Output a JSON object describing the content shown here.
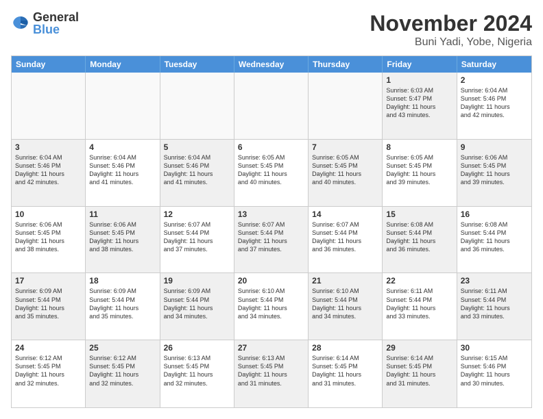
{
  "logo": {
    "general": "General",
    "blue": "Blue"
  },
  "title": "November 2024",
  "location": "Buni Yadi, Yobe, Nigeria",
  "header_days": [
    "Sunday",
    "Monday",
    "Tuesday",
    "Wednesday",
    "Thursday",
    "Friday",
    "Saturday"
  ],
  "weeks": [
    [
      {
        "day": "",
        "text": "",
        "empty": true
      },
      {
        "day": "",
        "text": "",
        "empty": true
      },
      {
        "day": "",
        "text": "",
        "empty": true
      },
      {
        "day": "",
        "text": "",
        "empty": true
      },
      {
        "day": "",
        "text": "",
        "empty": true
      },
      {
        "day": "1",
        "text": "Sunrise: 6:03 AM\nSunset: 5:47 PM\nDaylight: 11 hours\nand 43 minutes.",
        "shaded": true
      },
      {
        "day": "2",
        "text": "Sunrise: 6:04 AM\nSunset: 5:46 PM\nDaylight: 11 hours\nand 42 minutes.",
        "shaded": false
      }
    ],
    [
      {
        "day": "3",
        "text": "Sunrise: 6:04 AM\nSunset: 5:46 PM\nDaylight: 11 hours\nand 42 minutes.",
        "shaded": true
      },
      {
        "day": "4",
        "text": "Sunrise: 6:04 AM\nSunset: 5:46 PM\nDaylight: 11 hours\nand 41 minutes.",
        "shaded": false
      },
      {
        "day": "5",
        "text": "Sunrise: 6:04 AM\nSunset: 5:46 PM\nDaylight: 11 hours\nand 41 minutes.",
        "shaded": true
      },
      {
        "day": "6",
        "text": "Sunrise: 6:05 AM\nSunset: 5:45 PM\nDaylight: 11 hours\nand 40 minutes.",
        "shaded": false
      },
      {
        "day": "7",
        "text": "Sunrise: 6:05 AM\nSunset: 5:45 PM\nDaylight: 11 hours\nand 40 minutes.",
        "shaded": true
      },
      {
        "day": "8",
        "text": "Sunrise: 6:05 AM\nSunset: 5:45 PM\nDaylight: 11 hours\nand 39 minutes.",
        "shaded": false
      },
      {
        "day": "9",
        "text": "Sunrise: 6:06 AM\nSunset: 5:45 PM\nDaylight: 11 hours\nand 39 minutes.",
        "shaded": true
      }
    ],
    [
      {
        "day": "10",
        "text": "Sunrise: 6:06 AM\nSunset: 5:45 PM\nDaylight: 11 hours\nand 38 minutes.",
        "shaded": false
      },
      {
        "day": "11",
        "text": "Sunrise: 6:06 AM\nSunset: 5:45 PM\nDaylight: 11 hours\nand 38 minutes.",
        "shaded": true
      },
      {
        "day": "12",
        "text": "Sunrise: 6:07 AM\nSunset: 5:44 PM\nDaylight: 11 hours\nand 37 minutes.",
        "shaded": false
      },
      {
        "day": "13",
        "text": "Sunrise: 6:07 AM\nSunset: 5:44 PM\nDaylight: 11 hours\nand 37 minutes.",
        "shaded": true
      },
      {
        "day": "14",
        "text": "Sunrise: 6:07 AM\nSunset: 5:44 PM\nDaylight: 11 hours\nand 36 minutes.",
        "shaded": false
      },
      {
        "day": "15",
        "text": "Sunrise: 6:08 AM\nSunset: 5:44 PM\nDaylight: 11 hours\nand 36 minutes.",
        "shaded": true
      },
      {
        "day": "16",
        "text": "Sunrise: 6:08 AM\nSunset: 5:44 PM\nDaylight: 11 hours\nand 36 minutes.",
        "shaded": false
      }
    ],
    [
      {
        "day": "17",
        "text": "Sunrise: 6:09 AM\nSunset: 5:44 PM\nDaylight: 11 hours\nand 35 minutes.",
        "shaded": true
      },
      {
        "day": "18",
        "text": "Sunrise: 6:09 AM\nSunset: 5:44 PM\nDaylight: 11 hours\nand 35 minutes.",
        "shaded": false
      },
      {
        "day": "19",
        "text": "Sunrise: 6:09 AM\nSunset: 5:44 PM\nDaylight: 11 hours\nand 34 minutes.",
        "shaded": true
      },
      {
        "day": "20",
        "text": "Sunrise: 6:10 AM\nSunset: 5:44 PM\nDaylight: 11 hours\nand 34 minutes.",
        "shaded": false
      },
      {
        "day": "21",
        "text": "Sunrise: 6:10 AM\nSunset: 5:44 PM\nDaylight: 11 hours\nand 34 minutes.",
        "shaded": true
      },
      {
        "day": "22",
        "text": "Sunrise: 6:11 AM\nSunset: 5:44 PM\nDaylight: 11 hours\nand 33 minutes.",
        "shaded": false
      },
      {
        "day": "23",
        "text": "Sunrise: 6:11 AM\nSunset: 5:44 PM\nDaylight: 11 hours\nand 33 minutes.",
        "shaded": true
      }
    ],
    [
      {
        "day": "24",
        "text": "Sunrise: 6:12 AM\nSunset: 5:45 PM\nDaylight: 11 hours\nand 32 minutes.",
        "shaded": false
      },
      {
        "day": "25",
        "text": "Sunrise: 6:12 AM\nSunset: 5:45 PM\nDaylight: 11 hours\nand 32 minutes.",
        "shaded": true
      },
      {
        "day": "26",
        "text": "Sunrise: 6:13 AM\nSunset: 5:45 PM\nDaylight: 11 hours\nand 32 minutes.",
        "shaded": false
      },
      {
        "day": "27",
        "text": "Sunrise: 6:13 AM\nSunset: 5:45 PM\nDaylight: 11 hours\nand 31 minutes.",
        "shaded": true
      },
      {
        "day": "28",
        "text": "Sunrise: 6:14 AM\nSunset: 5:45 PM\nDaylight: 11 hours\nand 31 minutes.",
        "shaded": false
      },
      {
        "day": "29",
        "text": "Sunrise: 6:14 AM\nSunset: 5:45 PM\nDaylight: 11 hours\nand 31 minutes.",
        "shaded": true
      },
      {
        "day": "30",
        "text": "Sunrise: 6:15 AM\nSunset: 5:46 PM\nDaylight: 11 hours\nand 30 minutes.",
        "shaded": false
      }
    ]
  ]
}
